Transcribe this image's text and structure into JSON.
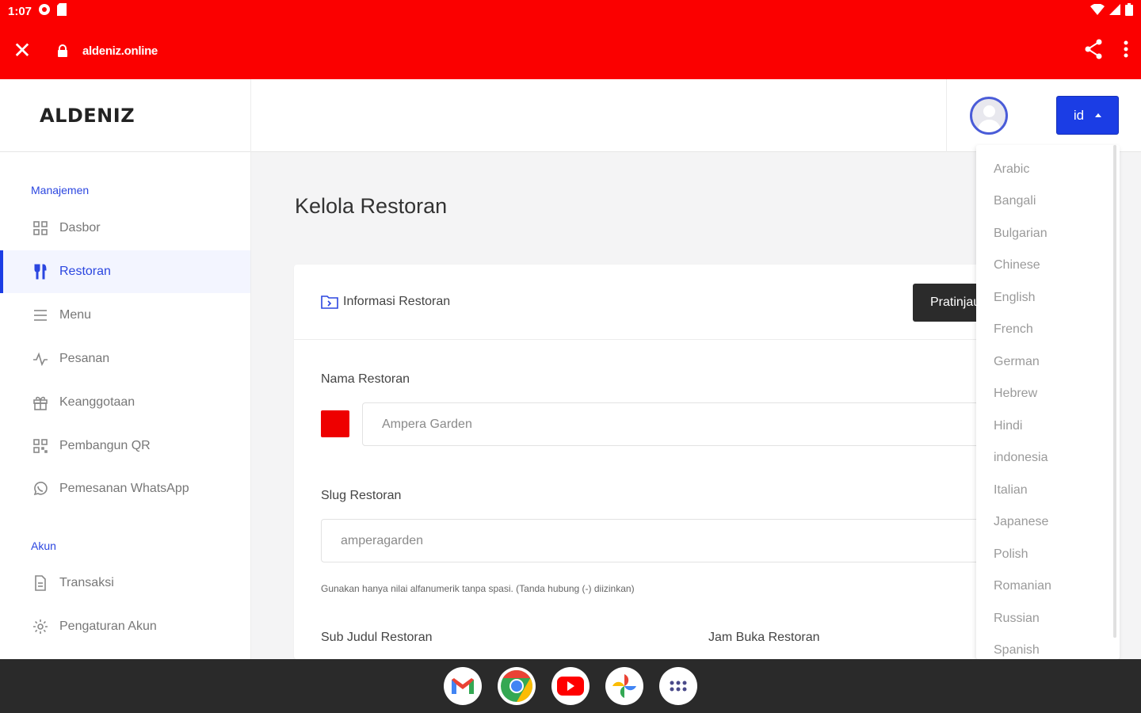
{
  "status": {
    "time": "1:07"
  },
  "browser": {
    "url": "aldeniz.online"
  },
  "brand": {
    "name": "ALDENIZ"
  },
  "header": {
    "lang_code": "id"
  },
  "sidebar": {
    "sections": [
      {
        "label": "Manajemen"
      },
      {
        "label": "Akun"
      }
    ],
    "items": [
      {
        "label": "Dasbor",
        "icon": "grid-icon"
      },
      {
        "label": "Restoran",
        "icon": "fork-knife-icon"
      },
      {
        "label": "Menu",
        "icon": "list-icon"
      },
      {
        "label": "Pesanan",
        "icon": "pulse-icon"
      },
      {
        "label": "Keanggotaan",
        "icon": "gift-icon"
      },
      {
        "label": "Pembangun QR",
        "icon": "qr-icon"
      },
      {
        "label": "Pemesanan WhatsApp",
        "icon": "whatsapp-icon"
      },
      {
        "label": "Transaksi",
        "icon": "document-icon"
      },
      {
        "label": "Pengaturan Akun",
        "icon": "gear-icon"
      }
    ]
  },
  "main": {
    "title": "Kelola Restoran",
    "card": {
      "header": "Informasi Restoran",
      "preview_button": "Pratinjau",
      "name_label": "Nama Restoran",
      "name_value": "Ampera Garden",
      "name_color": "#ee0000",
      "slug_label": "Slug Restoran",
      "slug_value": "amperagarden",
      "slug_help": "Gunakan hanya nilai alfanumerik tanpa spasi. (Tanda hubung (-) diizinkan)",
      "subtitle_label": "Sub Judul Restoran",
      "hours_label": "Jam Buka Restoran"
    }
  },
  "language_dropdown": {
    "options": [
      "Arabic",
      "Bangali",
      "Bulgarian",
      "Chinese",
      "English",
      "French",
      "German",
      "Hebrew",
      "Hindi",
      "indonesia",
      "Italian",
      "Japanese",
      "Polish",
      "Romanian",
      "Russian",
      "Spanish"
    ]
  },
  "dock": {
    "apps": [
      "gmail-icon",
      "chrome-icon",
      "youtube-icon",
      "photos-icon",
      "app-drawer-icon"
    ]
  },
  "colors": {
    "status_bar": "#fb0000",
    "accent": "#1b3de5"
  }
}
